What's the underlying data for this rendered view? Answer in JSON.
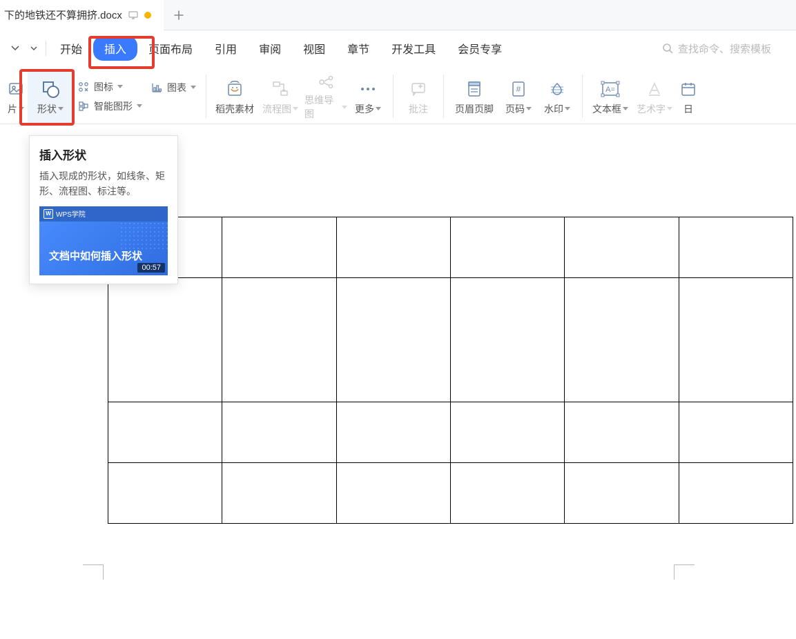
{
  "tab": {
    "filename": "下的地铁还不算拥挤.docx"
  },
  "menu": {
    "items": [
      "开始",
      "插入",
      "页面布局",
      "引用",
      "审阅",
      "视图",
      "章节",
      "开发工具",
      "会员专享"
    ],
    "active_index": 1,
    "search_placeholder": "查找命令、搜索模板"
  },
  "ribbon": {
    "pic_trunc": "片",
    "shape": "形状",
    "icons": "图标",
    "chart": "图表",
    "smartart": "智能图形",
    "daoke": "稻壳素材",
    "flowchart": "流程图",
    "mindmap": "思维导图",
    "more": "更多",
    "comment": "批注",
    "header_footer": "页眉页脚",
    "page_number": "页码",
    "watermark": "水印",
    "textbox": "文本框",
    "wordart": "艺术字",
    "date_trunc": "日"
  },
  "tooltip": {
    "title": "插入形状",
    "desc": "插入现成的形状，如线条、矩形、流程图、标注等。",
    "thumb_banner": "WPS学院",
    "thumb_title": "文档中如何插入形状",
    "duration": "00:57"
  }
}
